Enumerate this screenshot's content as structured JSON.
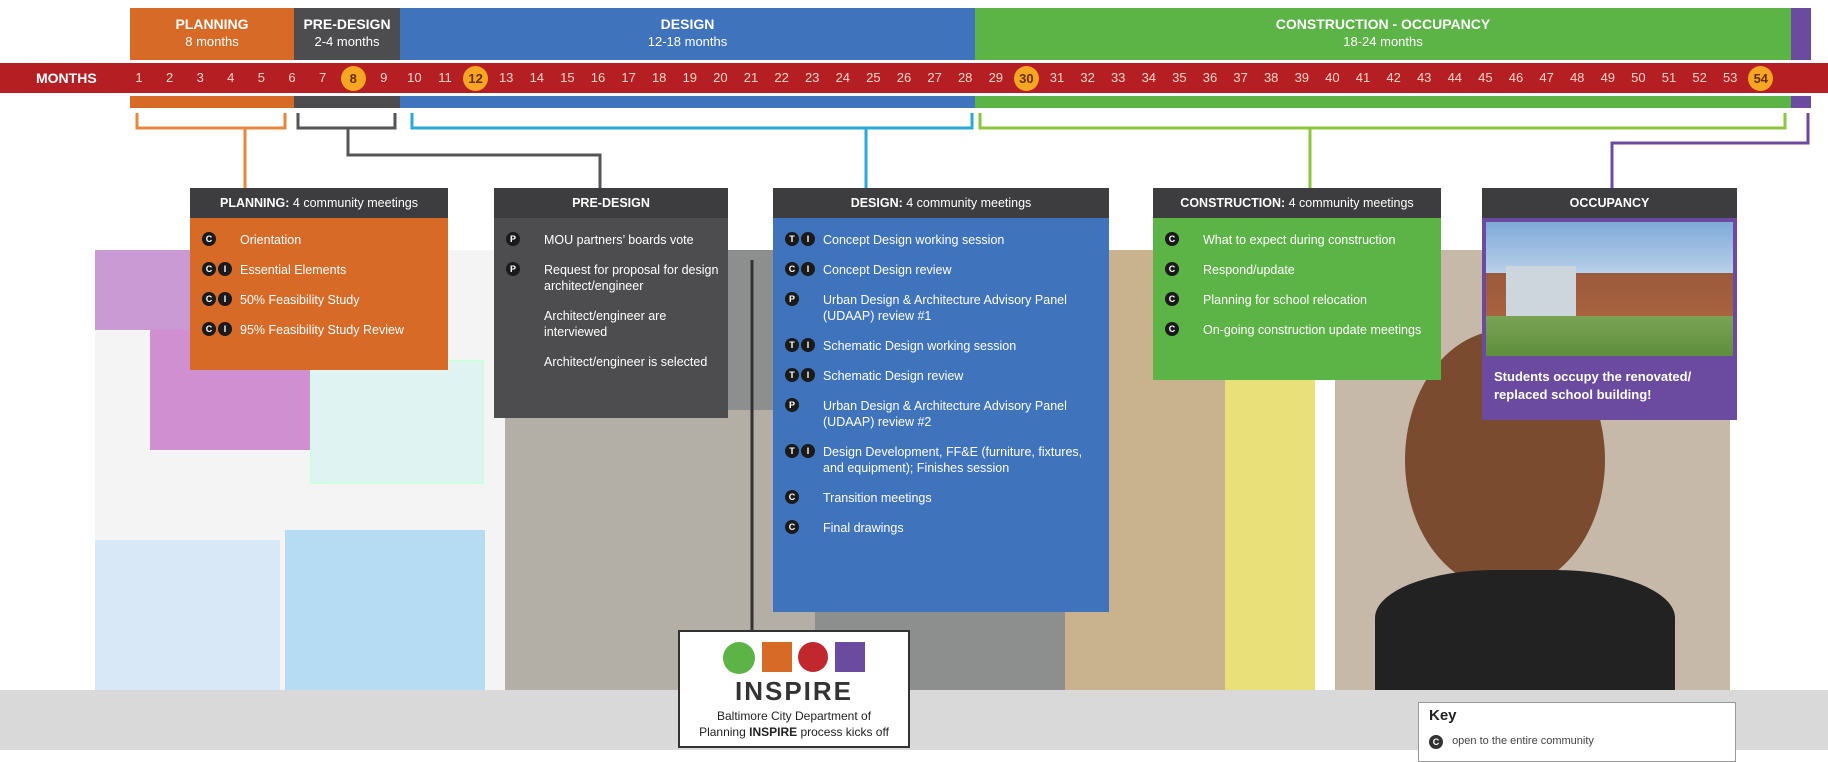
{
  "phases": [
    {
      "name": "PLANNING",
      "duration": "8 months",
      "color": "#d86a28"
    },
    {
      "name": "PRE-DESIGN",
      "duration": "2-4 months",
      "color": "#4d4d4f"
    },
    {
      "name": "DESIGN",
      "duration": "12-18 months",
      "color": "#3f74bd"
    },
    {
      "name": "CONSTRUCTION - OCCUPANCY",
      "duration": "18-24 months",
      "color": "#5cb346"
    }
  ],
  "months_label": "MONTHS",
  "months": [
    "1",
    "2",
    "3",
    "4",
    "5",
    "6",
    "7",
    "8",
    "9",
    "10",
    "11",
    "12",
    "13",
    "14",
    "15",
    "16",
    "17",
    "18",
    "19",
    "20",
    "21",
    "22",
    "23",
    "24",
    "25",
    "26",
    "27",
    "28",
    "29",
    "30",
    "31",
    "32",
    "33",
    "34",
    "35",
    "36",
    "37",
    "38",
    "39",
    "40",
    "41",
    "42",
    "43",
    "44",
    "45",
    "46",
    "47",
    "48",
    "49",
    "50",
    "51",
    "52",
    "53",
    "54"
  ],
  "key_months": [
    "8",
    "12",
    "30",
    "54"
  ],
  "boxes": {
    "planning": {
      "title_bold": "PLANNING:",
      "title_rest": " 4 community meetings",
      "items": [
        {
          "badges": [
            "C"
          ],
          "text": "Orientation"
        },
        {
          "badges": [
            "C",
            "I"
          ],
          "text": "Essential Elements"
        },
        {
          "badges": [
            "C",
            "I"
          ],
          "text": "50% Feasibility Study"
        },
        {
          "badges": [
            "C",
            "I"
          ],
          "text": "95% Feasibility Study Review"
        }
      ]
    },
    "predesign": {
      "title_bold": "PRE-DESIGN",
      "items": [
        {
          "badges": [
            "P"
          ],
          "text": "MOU partners’ boards vote"
        },
        {
          "badges": [
            "P"
          ],
          "text": "Request for proposal for design architect/engineer"
        },
        {
          "badges": [],
          "text": "Architect/engineer are interviewed"
        },
        {
          "badges": [],
          "text": "Architect/engineer is selected"
        }
      ]
    },
    "design": {
      "title_bold": "DESIGN:",
      "title_rest": " 4 community meetings",
      "items": [
        {
          "badges": [
            "T",
            "I"
          ],
          "text": "Concept Design working session"
        },
        {
          "badges": [
            "C",
            "I"
          ],
          "text": "Concept Design review"
        },
        {
          "badges": [
            "P"
          ],
          "text": "Urban Design & Architecture Advisory Panel (UDAAP) review #1"
        },
        {
          "badges": [
            "T",
            "I"
          ],
          "text": "Schematic Design working session"
        },
        {
          "badges": [
            "T",
            "I"
          ],
          "text": "Schematic Design review"
        },
        {
          "badges": [
            "P"
          ],
          "text": "Urban Design & Architecture Advisory Panel (UDAAP) review #2"
        },
        {
          "badges": [
            "T",
            "I"
          ],
          "text": "Design Development, FF&E (furniture, fixtures, and equipment); Finishes session"
        },
        {
          "badges": [
            "C"
          ],
          "text": "Transition meetings"
        },
        {
          "badges": [
            "C"
          ],
          "text": "Final drawings"
        }
      ]
    },
    "construction": {
      "title_bold": "CONSTRUCTION:",
      "title_rest": " 4 community meetings",
      "items": [
        {
          "badges": [
            "C"
          ],
          "text": "What to expect during construction"
        },
        {
          "badges": [
            "C"
          ],
          "text": "Respond/update"
        },
        {
          "badges": [
            "C"
          ],
          "text": "Planning for school relocation"
        },
        {
          "badges": [
            "C"
          ],
          "text": "On-going construction update meetings"
        }
      ]
    },
    "occupancy": {
      "title_bold": "OCCUPANCY",
      "caption": "Students occupy the renovated/ replaced school building!"
    }
  },
  "inspire": {
    "wordmark": "INSPIRE",
    "line1": "Baltimore City Department of",
    "line2_pre": "Planning ",
    "line2_bold": "INSPIRE",
    "line2_post": " process kicks off"
  },
  "key": {
    "title": "Key",
    "entry_badge": "C",
    "entry_text": "open to the entire community"
  },
  "colors": {
    "planning": "#d86a28",
    "predesign": "#4d4d4f",
    "design": "#3f74bd",
    "construction": "#5cb346",
    "occupancy": "#6b4ba0",
    "ribbon": "#b51f24",
    "key_month": "#f6a623",
    "connector_planning": "#e6873c",
    "connector_predesign": "#555555",
    "connector_design": "#2aa8d8",
    "connector_construction": "#8cc63f",
    "connector_occupancy": "#6b4ba0"
  }
}
